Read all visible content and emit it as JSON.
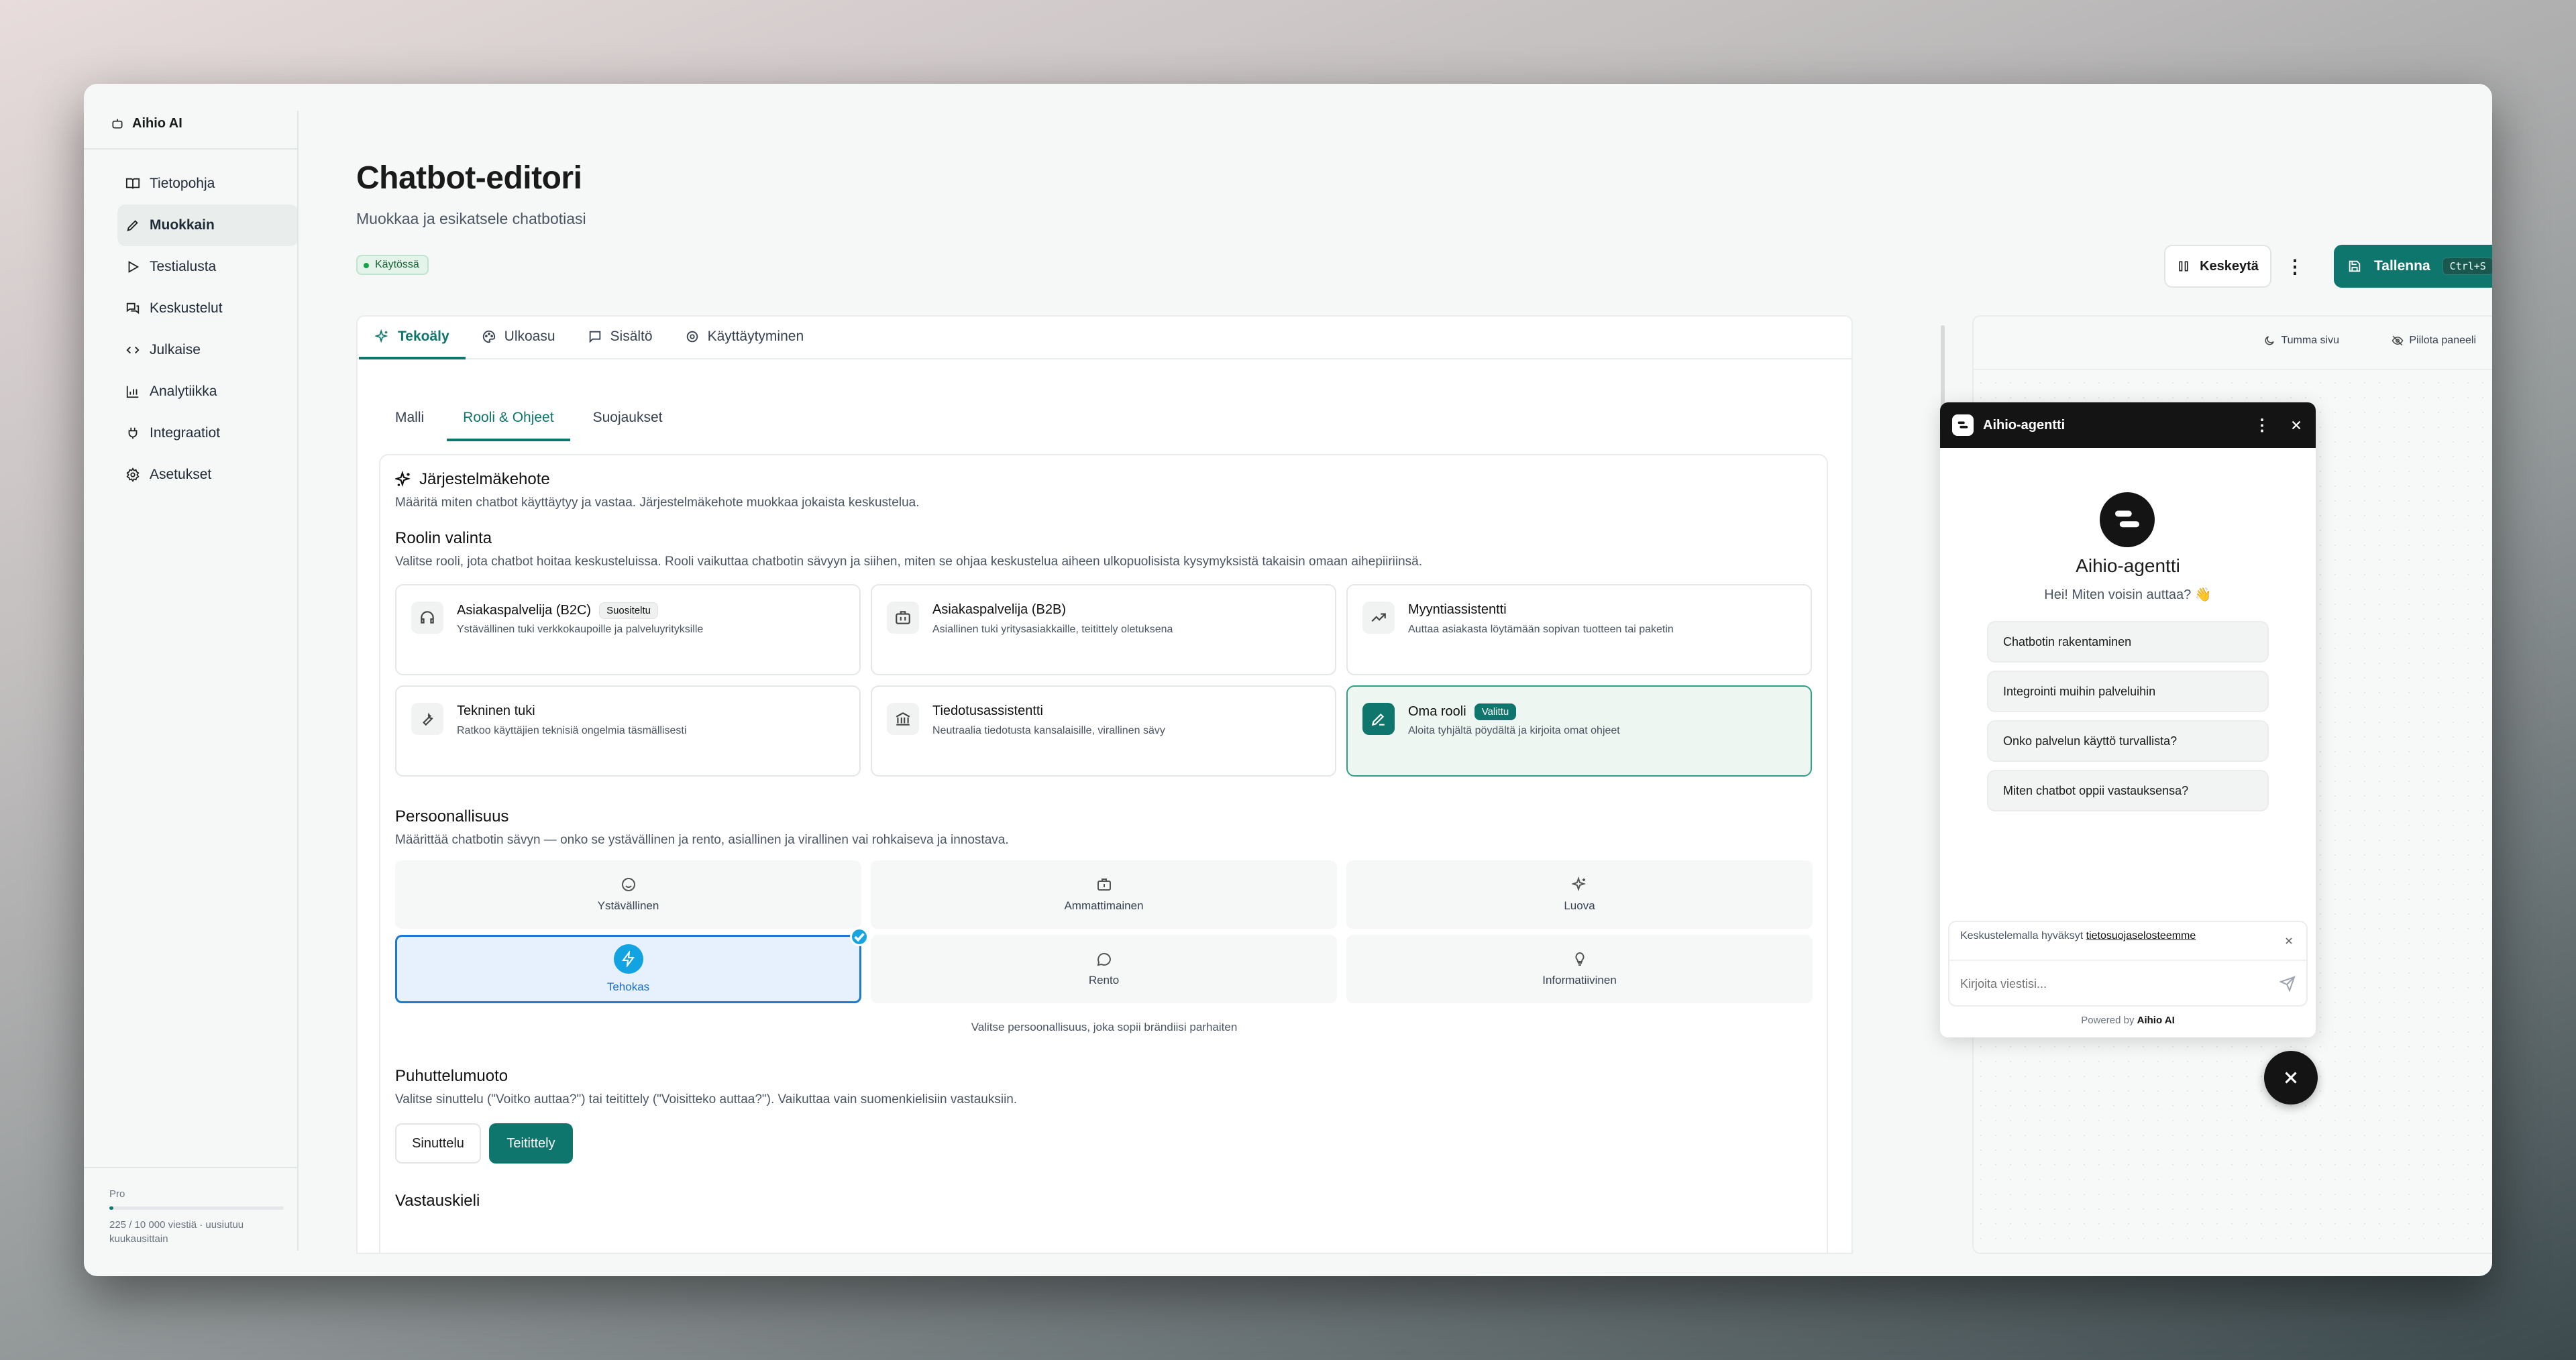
{
  "app": {
    "brand": "Aihio AI"
  },
  "sidebar": {
    "items": [
      {
        "label": "Tietopohja",
        "icon": "book-icon"
      },
      {
        "label": "Muokkain",
        "icon": "pencil-icon"
      },
      {
        "label": "Testialusta",
        "icon": "play-icon"
      },
      {
        "label": "Keskustelut",
        "icon": "messages-icon"
      },
      {
        "label": "Julkaise",
        "icon": "code-icon"
      },
      {
        "label": "Analytiikka",
        "icon": "chart-icon"
      },
      {
        "label": "Integraatiot",
        "icon": "plug-icon"
      },
      {
        "label": "Asetukset",
        "icon": "gear-icon"
      }
    ],
    "active_index": 1
  },
  "plan": {
    "name": "Pro",
    "usage_text": "225 / 10 000 viestiä · uusiutuu kuukausittain",
    "usage_fraction": 0.0225
  },
  "header": {
    "title": "Chatbot-editori",
    "subtitle": "Muokkaa ja esikatsele chatbotiasi",
    "status": "Käytössä",
    "pause_label": "Keskeytä",
    "more_label": "⋮",
    "save_label": "Tallenna",
    "save_shortcut": "Ctrl+S"
  },
  "tabs": [
    {
      "label": "Tekoäly",
      "active": true
    },
    {
      "label": "Ulkoasu"
    },
    {
      "label": "Sisältö"
    },
    {
      "label": "Käyttäytyminen"
    }
  ],
  "subtabs": [
    {
      "label": "Malli"
    },
    {
      "label": "Rooli & Ohjeet",
      "active": true
    },
    {
      "label": "Suojaukset"
    }
  ],
  "system_prompt": {
    "title": "Järjestelmäkehote",
    "desc": "Määritä miten chatbot käyttäytyy ja vastaa. Järjestelmäkehote muokkaa jokaista keskustelua."
  },
  "role_section": {
    "title": "Roolin valinta",
    "desc": "Valitse rooli, jota chatbot hoitaa keskusteluissa. Rooli vaikuttaa chatbotin sävyyn ja siihen, miten se ohjaa keskustelua aiheen ulkopuolisista kysymyksistä takaisin omaan aihepiiriinsä."
  },
  "roles": [
    {
      "title": "Asiakaspalvelija (B2C)",
      "tag": "Suositeltu",
      "desc": "Ystävällinen tuki verkkokaupoille ja palveluyrityksille",
      "icon": "headset-icon"
    },
    {
      "title": "Asiakaspalvelija (B2B)",
      "desc": "Asiallinen tuki yritysasiakkaille, teitittely oletuksena",
      "icon": "building-icon"
    },
    {
      "title": "Myyntiassistentti",
      "desc": "Auttaa asiakasta löytämään sopivan tuotteen tai paketin",
      "icon": "trend-icon"
    },
    {
      "title": "Tekninen tuki",
      "desc": "Ratkoo käyttäjien teknisiä ongelmia täsmällisesti",
      "icon": "wrench-icon"
    },
    {
      "title": "Tiedotusassistentti",
      "desc": "Neutraalia tiedotusta kansalaisille, virallinen sävy",
      "icon": "bank-icon"
    },
    {
      "title": "Oma rooli",
      "tag": "Valittu",
      "desc": "Aloita tyhjältä pöydältä ja kirjoita omat ohjeet",
      "icon": "pen-icon",
      "selected": true
    }
  ],
  "personality": {
    "title": "Persoonallisuus",
    "desc": "Määrittää chatbotin sävyn — onko se ystävällinen ja rento, asiallinen ja virallinen vai rohkaiseva ja innostava.",
    "hint": "Valitse persoonallisuus, joka sopii brändiisi parhaiten",
    "options": [
      {
        "label": "Ystävällinen",
        "icon": "smile-icon"
      },
      {
        "label": "Ammattimainen",
        "icon": "briefcase-icon"
      },
      {
        "label": "Luova",
        "icon": "sparkle-icon"
      },
      {
        "label": "Tehokas",
        "icon": "bolt-icon",
        "selected": true
      },
      {
        "label": "Rento",
        "icon": "chat-bubble-icon"
      },
      {
        "label": "Informatiivinen",
        "icon": "bulb-icon"
      }
    ]
  },
  "address": {
    "title": "Puhuttelumuoto",
    "desc": "Valitse sinuttelu (\"Voitko auttaa?\") tai teitittely (\"Voisitteko auttaa?\"). Vaikuttaa vain suomenkielisiin vastauksiin.",
    "options": [
      {
        "label": "Sinuttelu"
      },
      {
        "label": "Teitittely",
        "selected": true
      }
    ]
  },
  "next_section": {
    "title": "Vastauskieli"
  },
  "preview": {
    "dark_label": "Tumma sivu",
    "hide_label": "Piilota paneeli"
  },
  "chat": {
    "header_title": "Aihio-agentti",
    "agent_name": "Aihio-agentti",
    "greeting": "Hei! Miten voisin auttaa? 👋",
    "suggestions": [
      "Chatbotin rakentaminen",
      "Integrointi muihin palveluihin",
      "Onko palvelun käyttö turvallista?",
      "Miten chatbot oppii vastauksensa?"
    ],
    "consent_prefix": "Keskustelemalla hyväksyt",
    "consent_link": "tietosuojaselosteemme",
    "input_placeholder": "Kirjoita viestisi...",
    "powered_prefix": "Powered by",
    "powered_brand": "Aihio AI"
  },
  "colors": {
    "accent": "#0f766e",
    "selected_blue": "#1d78d6",
    "chat_dark": "#141414"
  }
}
